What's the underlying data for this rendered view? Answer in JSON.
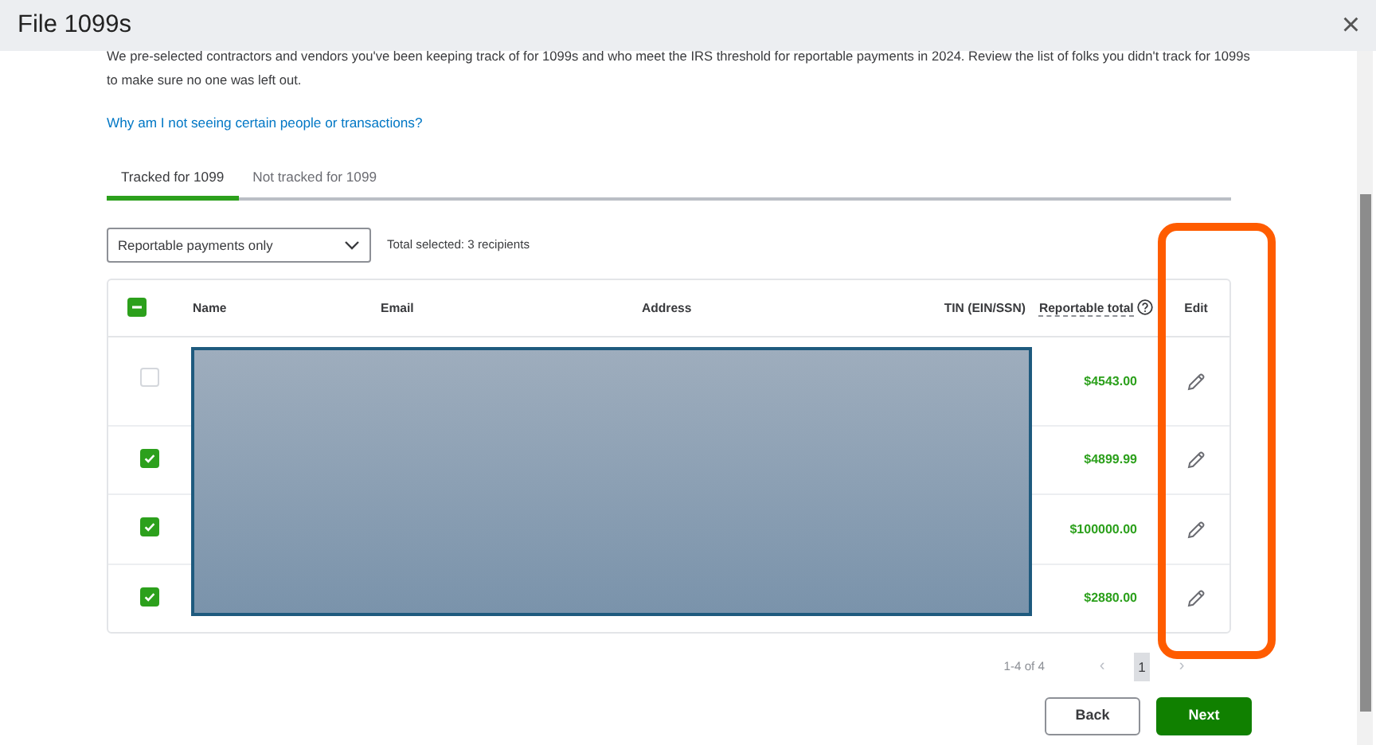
{
  "window": {
    "title": "File 1099s",
    "close": "×"
  },
  "intro": "We pre-selected contractors and vendors you've been keeping track of for 1099s and who meet the IRS threshold for reportable payments in 2024. Review the list of folks you didn't track for 1099s to make sure no one was left out.",
  "help_link": "Why am I not seeing certain people or transactions?",
  "tabs": [
    {
      "label": "Tracked for 1099",
      "selected": true
    },
    {
      "label": "Not tracked for 1099",
      "selected": false
    }
  ],
  "filter": {
    "value": "Reportable payments only"
  },
  "total_selected": "Total selected: 3 recipients",
  "table": {
    "select_all": {
      "indeterminate": true
    },
    "columns": [
      "Name",
      "Email",
      "Address",
      "TIN (EIN/SSN)",
      "Reportable total",
      "Edit"
    ],
    "rows": [
      {
        "checked": false,
        "reportable_total": "$4543.00"
      },
      {
        "checked": true,
        "reportable_total": "$4899.99"
      },
      {
        "checked": true,
        "reportable_total": "$100000.00"
      },
      {
        "checked": true,
        "reportable_total": "$2880.00"
      }
    ]
  },
  "pagination": {
    "range": "1-4 of 4",
    "prev": "‹",
    "next": "›",
    "pages": [
      {
        "label": "1",
        "selected": true
      }
    ]
  },
  "buttons": [
    {
      "label": "Back",
      "kind": "secondary"
    },
    {
      "label": "Next",
      "kind": "primary"
    }
  ]
}
